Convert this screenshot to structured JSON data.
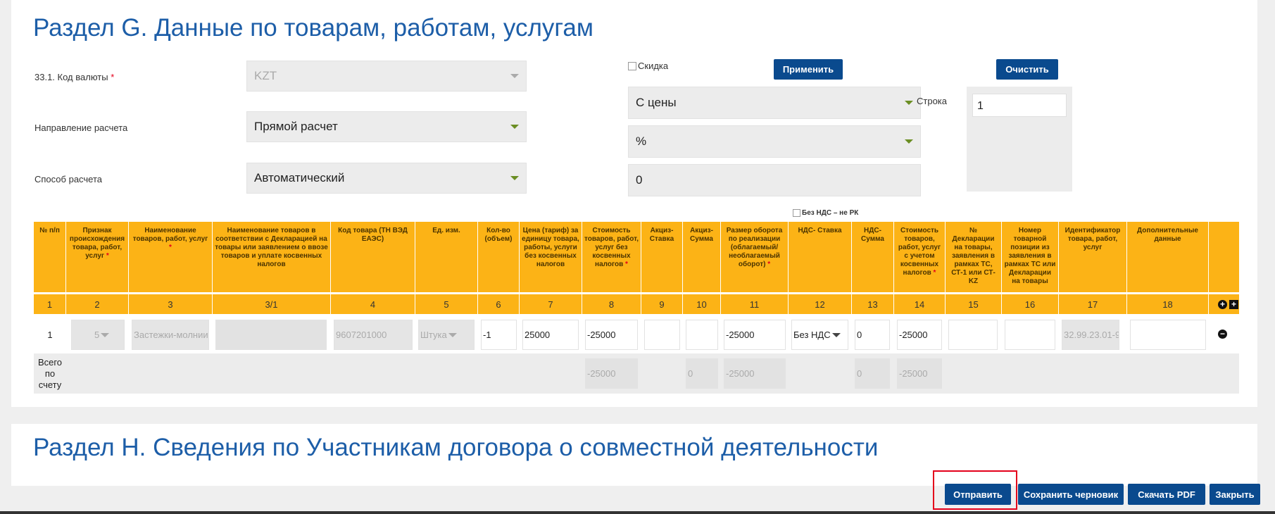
{
  "section_g": {
    "title": "Раздел G. Данные по товарам, работам, услугам",
    "currency_label": "33.1. Код валюты",
    "required_mark": "*",
    "currency_value": "KZT",
    "direction_label": "Направление расчета",
    "direction_value": "Прямой расчет",
    "method_label": "Способ расчета",
    "method_value": "Автоматический",
    "discount_checkbox": "Скидка",
    "apply_button": "Применить",
    "clear_button": "Очистить",
    "from_price_value": "С цены",
    "percent_value": "%",
    "discount_amount": "0",
    "row_label": "Строка",
    "row_value": "1",
    "no_vat_checkbox": "Без НДС – не РК"
  },
  "table": {
    "headers": [
      "№ п/п",
      "Признак происхождения товара, работ, услуг",
      "Наименование товаров, работ, услуг",
      "Наименование товаров в соответствии с Декларацией на товары или заявлением о ввозе товаров и уплате косвенных налогов",
      "Код товара (ТН ВЭД ЕАЭС)",
      "Ед. изм.",
      "Кол-во (объем)",
      "Цена (тариф) за единицу товара, работы, услуги без косвенных налогов",
      "Стоимость товаров, работ, услуг без косвенных налогов",
      "Акциз-Ставка",
      "Акциз-Сумма",
      "Размер оборота по реализации (облагаемый/необлагаемый оборот)",
      "НДС- Ставка",
      "НДС-Сумма",
      "Стоимость товаров, работ, услуг с учетом косвенных налогов",
      "№ Декларации на товары, заявления в рамках ТС, СТ-1 или СТ-KZ",
      "Номер товарной позиции из заявления в рамках ТС или Декларации на товары",
      "Идентификатор товара, работ, услуг",
      "Дополнительные данные"
    ],
    "numbers": [
      "1",
      "2",
      "3",
      "3/1",
      "4",
      "5",
      "6",
      "7",
      "8",
      "9",
      "10",
      "11",
      "12",
      "13",
      "14",
      "15",
      "16",
      "17",
      "18"
    ],
    "row": {
      "index": "1",
      "origin": "5",
      "name": "Застежки-молнии",
      "name_decl": "",
      "code": "9607201000",
      "unit": "Штука",
      "qty": "-1",
      "price": "25000",
      "cost": "-25000",
      "excise_rate": "",
      "excise_sum": "",
      "turnover": "-25000",
      "vat_rate": "Без НДС",
      "vat_sum": "0",
      "cost_with_tax": "-25000",
      "decl_no": "",
      "position_no": "",
      "identifier": "32.99.23.01-90",
      "extra": ""
    },
    "total": {
      "label": "Всего по счету",
      "cost": "-25000",
      "excise_sum": "0",
      "turnover": "-25000",
      "vat_sum": "0",
      "cost_with_tax": "-25000"
    }
  },
  "section_h": {
    "title": "Раздел H. Сведения по Участникам договора о совместной деятельности"
  },
  "actions": {
    "send": "Отправить",
    "save_draft": "Сохранить черновик",
    "download_pdf": "Скачать PDF",
    "close": "Закрыть"
  },
  "icons": {
    "add_row": "plus-circle-icon",
    "expand": "plus-square-icon",
    "remove_row": "minus-circle-icon"
  },
  "colors": {
    "title_blue": "#1d5ea8",
    "button_navy": "#0a4a8e",
    "header_orange": "#fcb316",
    "required_red": "#e4001b"
  }
}
